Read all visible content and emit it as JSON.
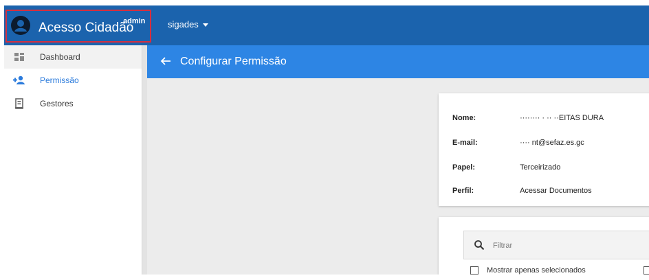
{
  "header": {
    "app_title": "Acesso Cidadão",
    "badge": "admin",
    "system_menu": "sigades"
  },
  "sidebar": {
    "items": [
      {
        "label": "Dashboard",
        "icon": "dashboard-icon"
      },
      {
        "label": "Permissão",
        "icon": "add-user-icon"
      },
      {
        "label": "Gestores",
        "icon": "building-icon"
      }
    ]
  },
  "page": {
    "title": "Configurar Permissão",
    "back_icon": "arrow-left-icon"
  },
  "user_info": {
    "nome_label": "Nome:",
    "nome_value": "········ · ·· ··EITAS DURA",
    "email_label": "E-mail:",
    "email_value": "····                   nt@sefaz.es.gc",
    "papel_label": "Papel:",
    "papel_value": "Terceirizado",
    "perfil_label": "Perfil:",
    "perfil_value": "Acessar Documentos"
  },
  "filter": {
    "placeholder": "Filtrar",
    "show_selected_label": "Mostrar apenas selecionados"
  },
  "colors": {
    "topbar": "#1b63ad",
    "header_strip": "#2d85e4",
    "accent": "#2b7bdc",
    "highlight_border": "#d62f3f"
  }
}
